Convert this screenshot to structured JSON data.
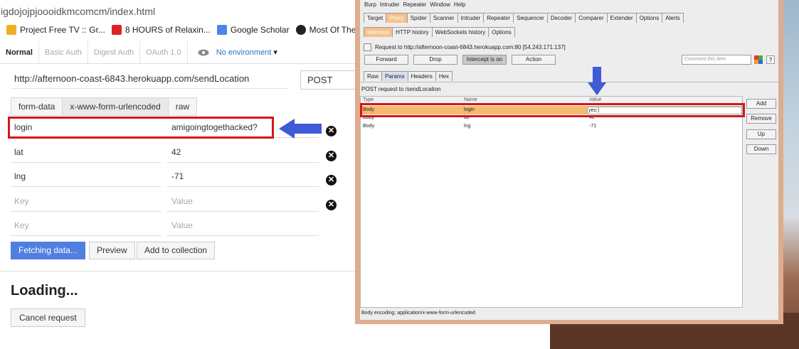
{
  "browser": {
    "url_text": "igdojojpjoooidkmcomcm/index.html",
    "bookmarks": [
      {
        "label": "Project Free TV :: Gr...",
        "icon": "star-icon"
      },
      {
        "label": "8 HOURS of Relaxin...",
        "icon": "youtube-icon"
      },
      {
        "label": "Google Scholar",
        "icon": "google-scholar-icon"
      },
      {
        "label": "Most Of The Web Is",
        "icon": "site-icon"
      }
    ]
  },
  "postman": {
    "auth_tabs": [
      "Normal",
      "Basic Auth",
      "Digest Auth",
      "OAuth 1.0"
    ],
    "environment": "No environment",
    "request_url": "http://afternoon-coast-6843.herokuapp.com/sendLocation",
    "method": "POST",
    "body_tabs": [
      "form-data",
      "x-www-form-urlencoded",
      "raw"
    ],
    "params": [
      {
        "key": "login",
        "value": "amigoingtogethacked?"
      },
      {
        "key": "lat",
        "value": "42"
      },
      {
        "key": "lng",
        "value": "-71"
      }
    ],
    "key_placeholder": "Key",
    "value_placeholder": "Value",
    "buttons": {
      "send": "Fetching data...",
      "preview": "Preview",
      "add_collection": "Add to collection"
    },
    "loading_text": "Loading...",
    "cancel_button": "Cancel request"
  },
  "burp": {
    "menu": [
      "Burp",
      "Intruder",
      "Repeater",
      "Window",
      "Help"
    ],
    "main_tabs": [
      "Target",
      "Proxy",
      "Spider",
      "Scanner",
      "Intruder",
      "Repeater",
      "Sequencer",
      "Decoder",
      "Comparer",
      "Extender",
      "Options",
      "Alerts"
    ],
    "proxy_tabs": [
      "Intercept",
      "HTTP history",
      "WebSockets history",
      "Options"
    ],
    "request_to": "Request to http://afternoon-coast-6843.herokuapp.com:80  [54.243.171.137]",
    "buttons": {
      "forward": "Forward",
      "drop": "Drop",
      "intercept": "Intercept is on",
      "action": "Action"
    },
    "comment_placeholder": "Comment this item",
    "help_label": "?",
    "view_tabs": [
      "Raw",
      "Params",
      "Headers",
      "Hex"
    ],
    "post_line": "POST request to /sendLocation",
    "columns": [
      "Type",
      "Name",
      "Value"
    ],
    "rows": [
      {
        "type": "Body",
        "name": "login",
        "value": "yes:)"
      },
      {
        "type": "Body",
        "name": "lat",
        "value": "42"
      },
      {
        "type": "Body",
        "name": "lng",
        "value": "-71"
      }
    ],
    "side_buttons": [
      "Add",
      "Remove",
      "Up",
      "Down"
    ],
    "body_encoding": "Body encoding: application/x-www-form-urlencoded"
  },
  "colors": {
    "highlight": "#d3161c",
    "arrow": "#3f5bd6",
    "send_button": "#4f7fe0",
    "burp_frame": "#deac8f",
    "burp_selected_row": "#f5b96f"
  }
}
